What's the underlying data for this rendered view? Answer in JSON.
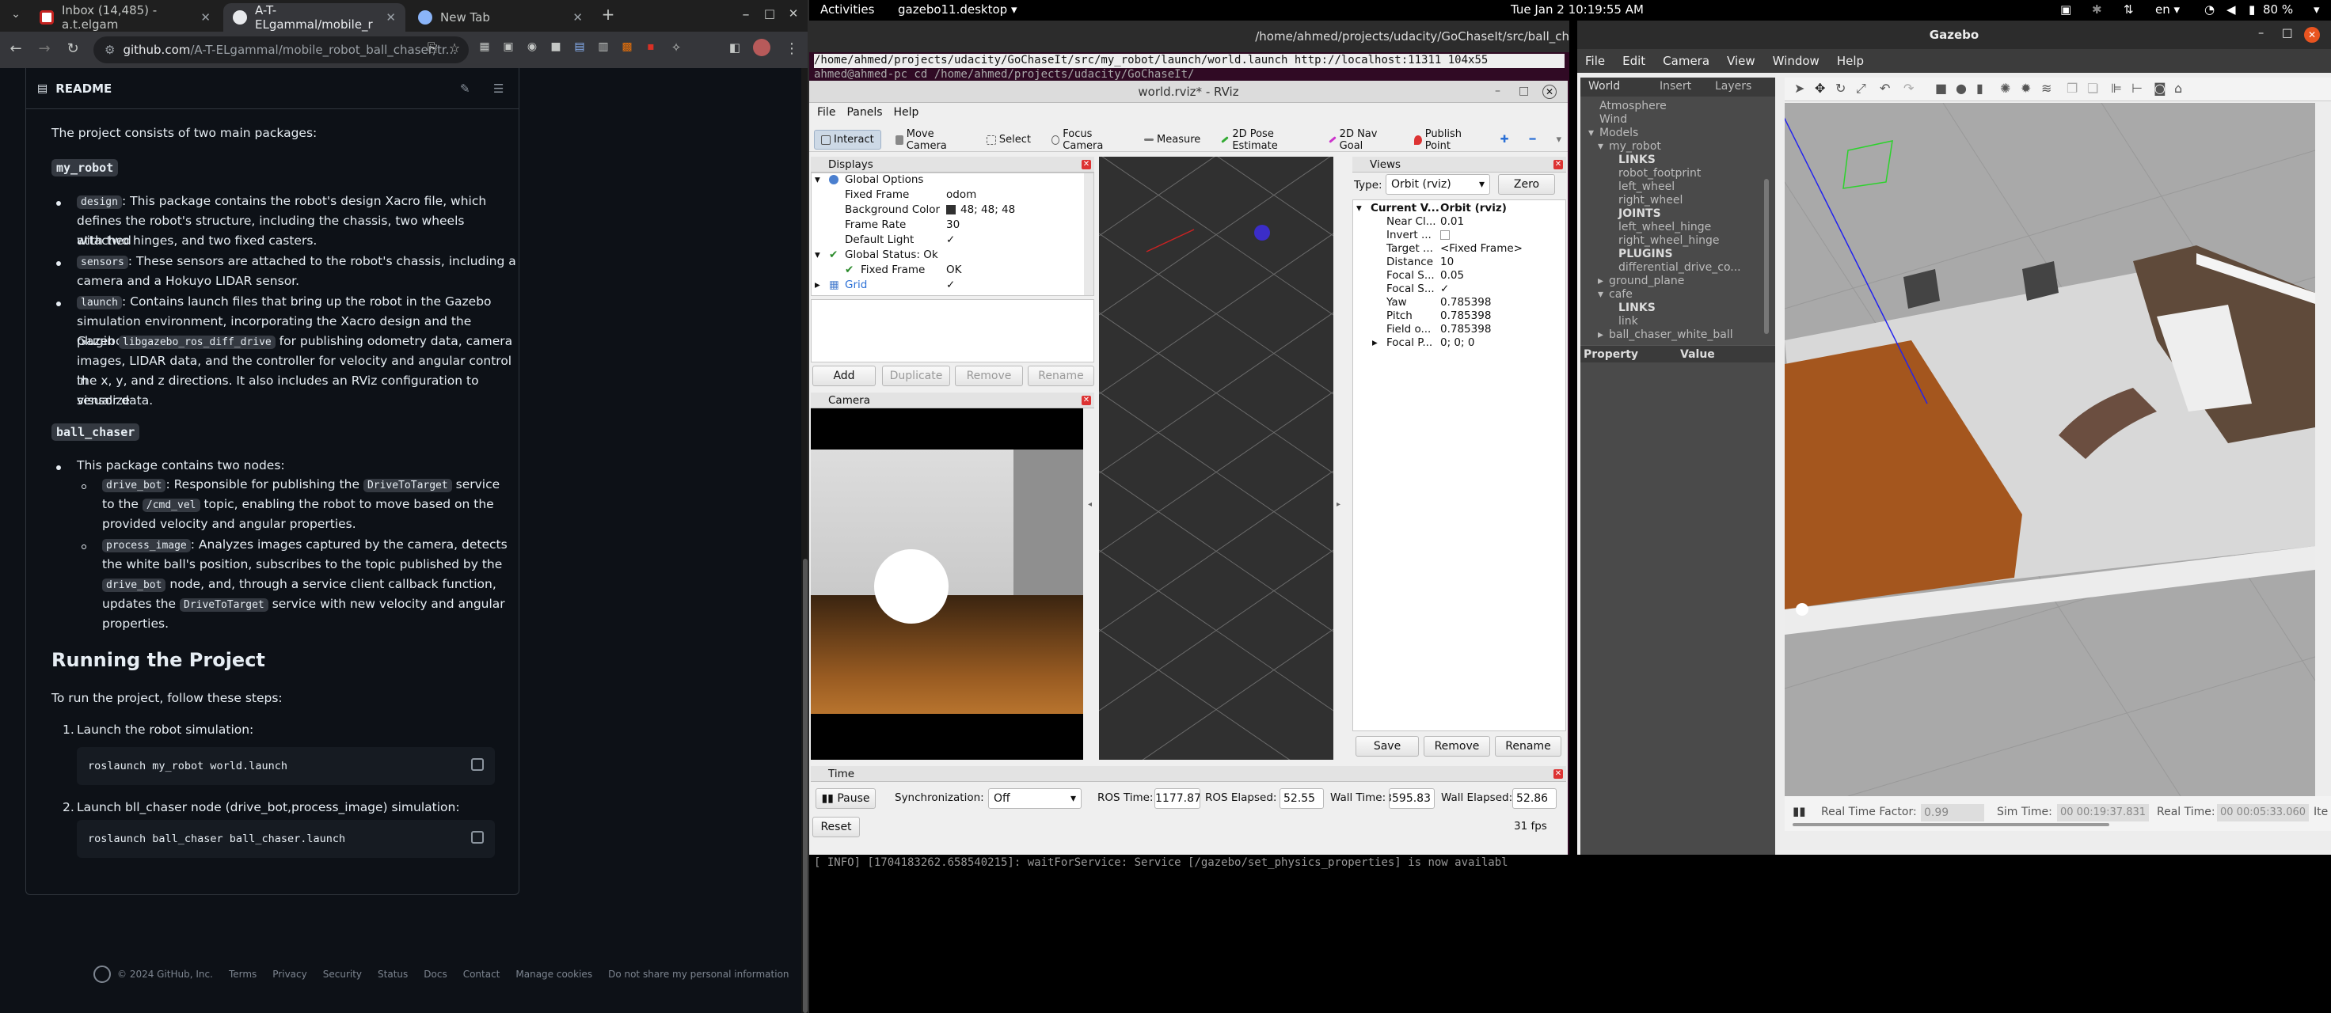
{
  "browser": {
    "tabs": [
      {
        "label": "Inbox (14,485) - a.t.elgam",
        "color": "#c5221f"
      },
      {
        "label": "A-T-ELgammal/mobile_r",
        "color": "#e8eaed"
      },
      {
        "label": "New Tab",
        "color": "#8ab4f8"
      }
    ],
    "url_host": "github.com",
    "url_path": "/A-T-ELgammal/mobile_robot_ball_chaser/tr...",
    "add_tab": "+",
    "win_min": "–",
    "win_max": "□",
    "win_close": "✕"
  },
  "readme": {
    "header": "README",
    "intro": "The project consists of two main packages:",
    "pkg1_title": "my_robot",
    "design_code": "design",
    "design_text_1": ": This package contains the robot's design Xacro file, which",
    "design_text_2": "defines the robot's structure, including the chassis, two wheels attached",
    "design_text_3": "with two hinges, and two fixed casters.",
    "sensors_code": "sensors",
    "sensors_text_1": ": These sensors are attached to the robot's chassis, including a",
    "sensors_text_2": "camera and a Hokuyo LIDAR sensor.",
    "launch_code": "launch",
    "launch_text_1": ": Contains launch files that bring up the robot in the Gazebo",
    "launch_text_2": "simulation environment, incorporating the Xacro design and the Gazebo",
    "launch_text_3a": "plugin",
    "launch_plugin_code": "libgazebo_ros_diff_drive",
    "launch_text_3b": "for publishing odometry data, camera",
    "launch_text_4": "images, LIDAR data, and the controller for velocity and angular control in",
    "launch_text_5": "the x, y, and z directions. It also includes an RViz configuration to visualize",
    "launch_text_6": "sensor data.",
    "pkg2_title": "ball_chaser",
    "nodes_text": "This package contains two nodes:",
    "drive_code": "drive_bot",
    "drive_text_1": ": Responsible for publishing the",
    "drive_service_code": "DriveToTarget",
    "drive_text_1b": "service",
    "drive_text_2a": "to the",
    "drive_topic_code": "/cmd_vel",
    "drive_text_2b": "topic, enabling the robot to move based on the",
    "drive_text_3": "provided velocity and angular properties.",
    "process_code": "process_image",
    "process_text_1": ": Analyzes images captured by the camera, detects",
    "process_text_2": "the white ball's position, subscribes to the topic published by the",
    "process_node_code": "drive_bot",
    "process_text_3": "node, and, through a service client callback function,",
    "process_text_4a": "updates the",
    "process_service_code": "DriveToTarget",
    "process_text_4b": "service with new velocity and angular",
    "process_text_5": "properties.",
    "run_title": "Running the Project",
    "run_intro": "To run the project, follow these steps:",
    "step1": "Launch the robot simulation:",
    "step1_cmd": "roslaunch my_robot world.launch",
    "step2": "Launch bll_chaser node (drive_bot,process_image) simulation:",
    "step2_cmd": "roslaunch ball_chaser ball_chaser.launch",
    "step1_num": "1.",
    "step2_num": "2."
  },
  "footer": [
    "© 2024 GitHub, Inc.",
    "Terms",
    "Privacy",
    "Security",
    "Status",
    "Docs",
    "Contact",
    "Manage cookies",
    "Do not share my personal information"
  ],
  "ubuntu": {
    "activities": "Activities",
    "app": "gazebo11.desktop ▾",
    "clock": "Tue Jan 2  10:19:55 AM",
    "lang": "en ▾",
    "battery": "80 %"
  },
  "terminal": {
    "title": "/home/ahmed/projects/udacity/GoChaseIt/src/ball_ch",
    "line1": "/home/ahmed/projects/udacity/GoChaseIt/src/my_robot/launch/world.launch http://localhost:11311 104x55",
    "line2": "ahmed@ahmed-pc      cd /home/ahmed/projects/udacity/GoChaseIt/",
    "bottom_line": "[ INFO] [1704183262.658540215]: waitForService: Service [/gazebo/set_physics_properties] is now availabl"
  },
  "rviz": {
    "title": "world.rviz* - RViz",
    "menu": [
      "File",
      "Panels",
      "Help"
    ],
    "tools": [
      "Interact",
      "Move Camera",
      "Select",
      "Focus Camera",
      "Measure",
      "2D Pose Estimate",
      "2D Nav Goal",
      "Publish Point"
    ],
    "displays_title": "Displays",
    "global_options": "Global Options",
    "fixed_frame_label": "Fixed Frame",
    "fixed_frame_value": "odom",
    "bg_color_label": "Background Color",
    "bg_color_value": "48; 48; 48",
    "frame_rate_label": "Frame Rate",
    "frame_rate_value": "30",
    "default_light_label": "Default Light",
    "default_light_value": "✓",
    "global_status": "Global Status: Ok",
    "gs_fixed_frame": "Fixed Frame",
    "gs_fixed_frame_value": "OK",
    "grid_label": "Grid",
    "grid_value": "✓",
    "add": "Add",
    "duplicate": "Duplicate",
    "remove": "Remove",
    "rename": "Rename",
    "camera_title": "Camera",
    "views_title": "Views",
    "type_label": "Type:",
    "type_value": "Orbit (rviz)",
    "zero": "Zero",
    "current_view": "Current V...",
    "current_view_value": "Orbit (rviz)",
    "near_clip": "Near Cl...",
    "near_clip_value": "0.01",
    "invert": "Invert ...",
    "target": "Target ...",
    "target_value": "<Fixed Frame>",
    "distance": "Distance",
    "distance_value": "10",
    "focal_s": "Focal S...",
    "focal_s_value": "0.05",
    "focal_s2": "Focal S...",
    "focal_s2_value": "✓",
    "yaw": "Yaw",
    "yaw_value": "0.785398",
    "pitch": "Pitch",
    "pitch_value": "0.785398",
    "field": "Field o...",
    "field_value": "0.785398",
    "focal_p": "Focal P...",
    "focal_p_value": "0; 0; 0",
    "save": "Save",
    "vremove": "Remove",
    "vrename": "Rename",
    "time_title": "Time",
    "pause": "Pause",
    "sync_label": "Synchronization:",
    "sync_value": "Off",
    "ros_time_label": "ROS Time:",
    "ros_time_value": "1177.87",
    "ros_elapsed_label": "ROS Elapsed:",
    "ros_elapsed_value": "52.55",
    "wall_time_label": "Wall Time:",
    "wall_time_value": "3595.83",
    "wall_elapsed_label": "Wall Elapsed:",
    "wall_elapsed_value": "52.86",
    "reset": "Reset",
    "fps": "31 fps"
  },
  "gazebo": {
    "title": "Gazebo",
    "menu": [
      "File",
      "Edit",
      "Camera",
      "View",
      "Window",
      "Help"
    ],
    "tabs": [
      "World",
      "Insert",
      "Layers"
    ],
    "tree": [
      {
        "label": "Atmosphere",
        "indent": 0,
        "arrow": "",
        "bold": false
      },
      {
        "label": "Wind",
        "indent": 0,
        "arrow": "",
        "bold": false
      },
      {
        "label": "Models",
        "indent": 0,
        "arrow": "▾",
        "bold": false
      },
      {
        "label": "my_robot",
        "indent": 1,
        "arrow": "▾",
        "bold": false
      },
      {
        "label": "LINKS",
        "indent": 2,
        "arrow": "",
        "bold": true
      },
      {
        "label": "robot_footprint",
        "indent": 2,
        "arrow": "",
        "bold": false
      },
      {
        "label": "left_wheel",
        "indent": 2,
        "arrow": "",
        "bold": false
      },
      {
        "label": "right_wheel",
        "indent": 2,
        "arrow": "",
        "bold": false
      },
      {
        "label": "JOINTS",
        "indent": 2,
        "arrow": "",
        "bold": true
      },
      {
        "label": "left_wheel_hinge",
        "indent": 2,
        "arrow": "",
        "bold": false
      },
      {
        "label": "right_wheel_hinge",
        "indent": 2,
        "arrow": "",
        "bold": false
      },
      {
        "label": "PLUGINS",
        "indent": 2,
        "arrow": "",
        "bold": true
      },
      {
        "label": "differential_drive_co...",
        "indent": 2,
        "arrow": "",
        "bold": false
      },
      {
        "label": "ground_plane",
        "indent": 1,
        "arrow": "▸",
        "bold": false
      },
      {
        "label": "cafe",
        "indent": 1,
        "arrow": "▾",
        "bold": false
      },
      {
        "label": "LINKS",
        "indent": 2,
        "arrow": "",
        "bold": true
      },
      {
        "label": "link",
        "indent": 2,
        "arrow": "",
        "bold": false
      },
      {
        "label": "ball_chaser_white_ball",
        "indent": 1,
        "arrow": "▸",
        "bold": false
      }
    ],
    "property_col": "Property",
    "value_col": "Value",
    "rtf_label": "Real Time Factor:",
    "rtf_value": "0.99",
    "sim_time_label": "Sim Time:",
    "sim_time_value": "00 00:19:37.831",
    "real_time_label": "Real Time:",
    "real_time_value": "00 00:05:33.060",
    "iter_label": "Ite"
  }
}
